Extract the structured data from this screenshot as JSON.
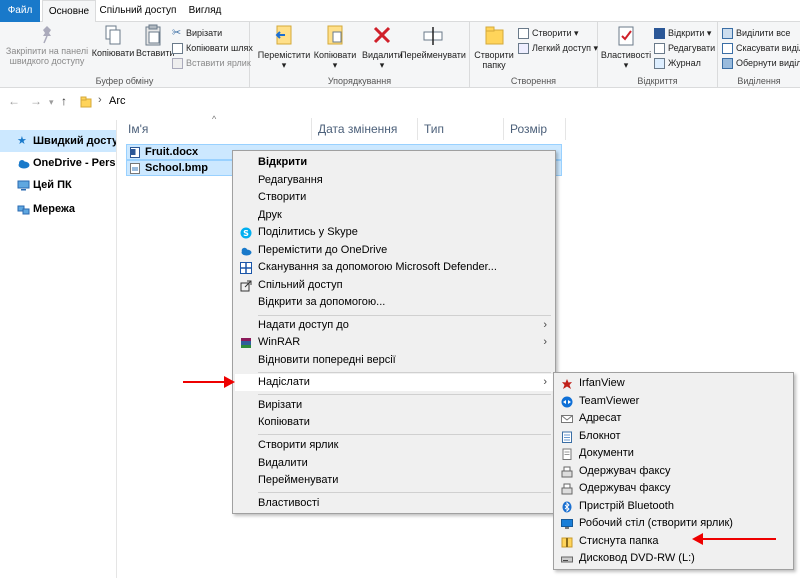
{
  "tabs": [
    "Файл",
    "Основне",
    "Спільний доступ",
    "Вигляд"
  ],
  "ribbon": {
    "clipboard": {
      "pin_line1": "Закріпити на панелі",
      "pin_line2": "швидкого доступу",
      "copy": "Копіювати",
      "paste": "Вставити",
      "cut": "Вирізати",
      "copy_path": "Копіювати шлях",
      "paste_shortcut": "Вставити ярлик",
      "label": "Буфер обміну"
    },
    "organize": {
      "move_to": "Перемістити",
      "copy_to": "Копіювати",
      "delete": "Видалити",
      "rename": "Перейменувати",
      "label": "Упорядкування"
    },
    "create": {
      "new_folder_line1": "Створити",
      "new_folder_line2": "папку",
      "new_item": "Створити",
      "easy_access": "Легкий доступ",
      "label": "Створення"
    },
    "open": {
      "properties": "Властивості",
      "open": "Відкрити",
      "edit": "Редагувати",
      "history": "Журнал",
      "label": "Відкриття"
    },
    "select": {
      "select_all": "Виділити все",
      "select_none": "Скасувати виділе",
      "invert": "Обернути виділен",
      "label": "Виділення"
    }
  },
  "address": {
    "path": "Arc"
  },
  "nav": [
    "Швидкий досту",
    "OneDrive - Pers",
    "Цей ПК",
    "Мережа"
  ],
  "columns": [
    "Ім'я",
    "Дата змінення",
    "Тип",
    "Розмір"
  ],
  "files": [
    "Fruit.docx",
    "School.bmp"
  ],
  "context_menu": {
    "items": [
      "Відкрити",
      "Редагування",
      "Створити",
      "Друк",
      "Поділитись у Skype",
      "Перемістити до OneDrive",
      "Сканування за допомогою Microsoft Defender...",
      "Спільний доступ",
      "Відкрити за допомогою...",
      "Надати доступ до",
      "WinRAR",
      "Відновити попередні версії",
      "Надіслати",
      "Вирізати",
      "Копіювати",
      "Створити ярлик",
      "Видалити",
      "Перейменувати",
      "Властивості"
    ]
  },
  "send_to_menu": {
    "items": [
      "IrfanView",
      "TeamViewer",
      "Адресат",
      "Блокнот",
      "Документи",
      "Одержувач факсу",
      "Одержувач факсу",
      "Пристрій Bluetooth",
      "Робочий стіл (створити ярлик)",
      "Стиснута папка",
      "Дисковод DVD-RW (L:)"
    ]
  },
  "colors": {
    "accent": "#1979ca",
    "selection": "#cce8ff",
    "arrow": "#e00000"
  }
}
